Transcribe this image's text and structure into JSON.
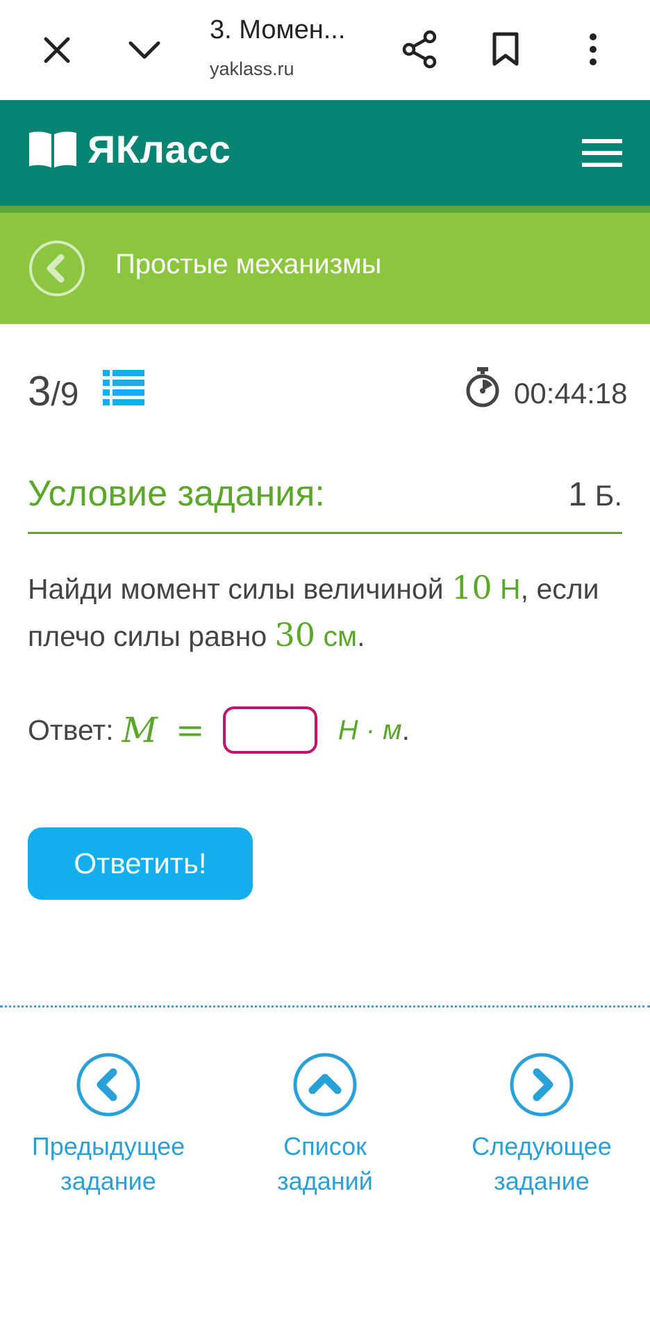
{
  "browser": {
    "tab_title": "3. Момен...",
    "url": "yaklass.ru"
  },
  "site": {
    "logo_text": "ЯКласс"
  },
  "topic": {
    "title": "Простые механизмы"
  },
  "progress": {
    "current": "3",
    "total": "/9",
    "timer": "00:44:18"
  },
  "condition": {
    "title": "Условие задания:",
    "points": "1",
    "points_unit": " Б."
  },
  "task": {
    "part1": "Найди момент силы величиной ",
    "force_value": "10",
    "force_unit": " Н",
    "part2": ", если плечо силы равно ",
    "arm_value": "30",
    "arm_unit": " см",
    "part3": "."
  },
  "answer": {
    "label": "Ответ: ",
    "variable": "M",
    "equals": "=",
    "input_value": "",
    "unit": "Н · м",
    "end": "."
  },
  "submit_label": "Ответить!",
  "nav": {
    "prev_line1": "Предыдущее",
    "prev_line2": "задание",
    "list_line1": "Список",
    "list_line2": "заданий",
    "next_line1": "Следующее",
    "next_line2": "задание"
  },
  "colors": {
    "header_teal": "#068672",
    "topic_green": "#8cc63f",
    "accent_green": "#5aa729",
    "button_blue": "#12aeee",
    "nav_blue": "#2aa0d8",
    "input_border": "#c0146f"
  }
}
